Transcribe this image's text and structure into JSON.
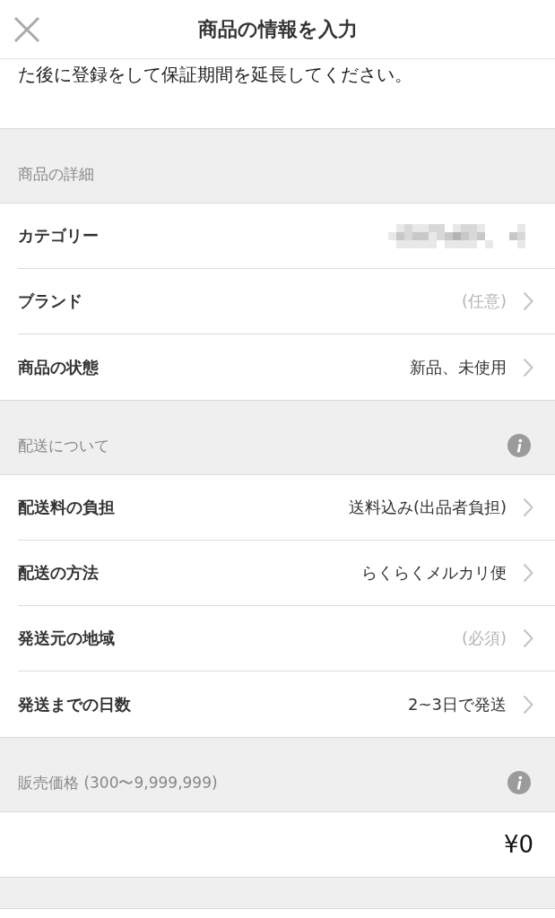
{
  "header": {
    "title": "商品の情報を入力"
  },
  "intro": "た後に登録をして保証期間を延長してください。",
  "sections": [
    {
      "title": "商品の詳細",
      "info": false,
      "rows": [
        {
          "kind": "redacted",
          "label": "カテゴリー"
        },
        {
          "kind": "select",
          "label": "ブランド",
          "placeholder": "(任意)"
        },
        {
          "kind": "select",
          "label": "商品の状態",
          "value": "新品、未使用"
        }
      ]
    },
    {
      "title": "配送について",
      "info": true,
      "rows": [
        {
          "kind": "select",
          "label": "配送料の負担",
          "value": "送料込み(出品者負担)"
        },
        {
          "kind": "select",
          "label": "配送の方法",
          "value": "らくらくメルカリ便"
        },
        {
          "kind": "select",
          "label": "発送元の地域",
          "placeholder": "(必須)"
        },
        {
          "kind": "select",
          "label": "発送までの日数",
          "value": "2~3日で発送"
        }
      ]
    },
    {
      "title": "販売価格 (300〜9,999,999)",
      "info": true,
      "rows": [
        {
          "kind": "price",
          "value": "¥0"
        }
      ]
    }
  ]
}
